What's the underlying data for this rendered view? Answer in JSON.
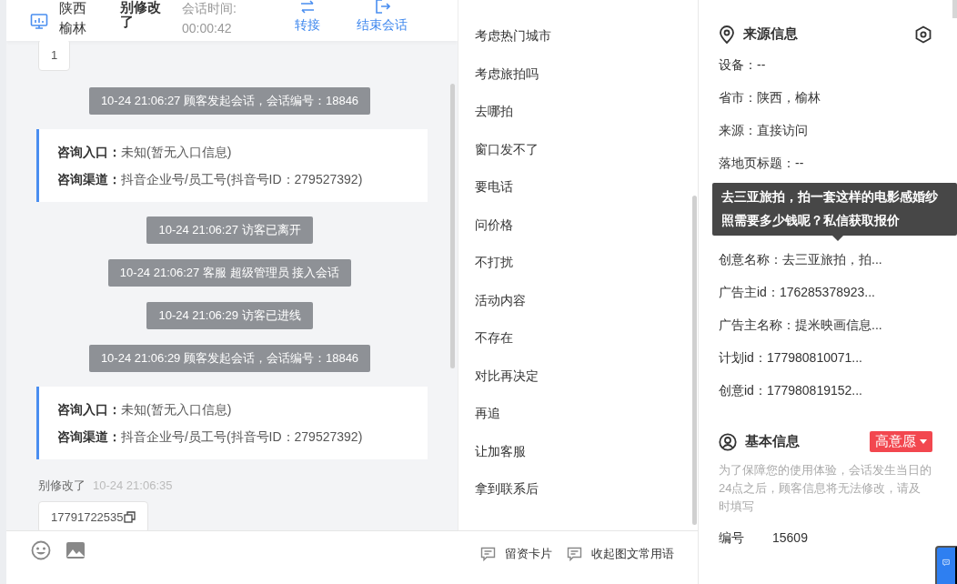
{
  "header": {
    "location": "陕西榆林",
    "name": "别修改了",
    "duration_label": "会话时间:",
    "duration": "00:00:42",
    "actions": [
      {
        "kind": "transfer",
        "label": "转接"
      },
      {
        "kind": "end",
        "label": "结束会话"
      }
    ]
  },
  "messages": [
    {
      "kind": "bubble",
      "text": "1",
      "copy": false
    },
    {
      "kind": "system",
      "text": "10-24 21:06:27 顾客发起会话，会话编号：18846"
    },
    {
      "kind": "entry",
      "lines": [
        {
          "label": "咨询入口：",
          "value": "未知(暂无入口信息)"
        },
        {
          "label": "咨询渠道：",
          "value": "抖音企业号/员工号(抖音号ID：279527392)"
        }
      ]
    },
    {
      "kind": "system",
      "text": "10-24 21:06:27 访客已离开"
    },
    {
      "kind": "system",
      "text": "10-24 21:06:27 客服 超级管理员 接入会话"
    },
    {
      "kind": "system",
      "text": "10-24 21:06:29 访客已进线"
    },
    {
      "kind": "system",
      "text": "10-24 21:06:29 顾客发起会话，会话编号：18846"
    },
    {
      "kind": "entry",
      "lines": [
        {
          "label": "咨询入口：",
          "value": "未知(暂无入口信息)"
        },
        {
          "label": "咨询渠道：",
          "value": "抖音企业号/员工号(抖音号ID：279527392)"
        }
      ]
    },
    {
      "kind": "sender",
      "name": "别修改了",
      "time": "10-24 21:06:35"
    },
    {
      "kind": "bubble",
      "text": "17791722535",
      "copy": true
    }
  ],
  "compose": {
    "links": [
      "留资卡片",
      "收起图文常用语"
    ]
  },
  "phrases": [
    "考虑热门城市",
    "考虑旅拍吗",
    "去哪拍",
    "窗口发不了",
    "要电话",
    "问价格",
    "不打扰",
    "活动内容",
    "不存在",
    "对比再决定",
    "再追",
    "让加客服",
    "拿到联系后"
  ],
  "source_info": {
    "title": "来源信息",
    "fields_before": [
      "设备：--",
      "省市：陕西，榆林",
      "来源：直接访问",
      "落地页标题：--"
    ],
    "tooltip": "去三亚旅拍，拍一套这样的电影感婚纱照需要多少钱呢？私信获取报价",
    "fields_after": [
      "创意名称：去三亚旅拍，拍...",
      "广告主id：176285378923...",
      "广告主名称：提米映画信息...",
      "计划id：177980810071...",
      "创意id：177980819152..."
    ]
  },
  "basic_info": {
    "title": "基本信息",
    "intent": "高意愿",
    "notice": "为了保障您的使用体验，会话发生当日的24点之后，顾客信息将无法修改，请及时填写",
    "fields": [
      {
        "label": "编号",
        "value": "15609"
      }
    ]
  }
}
